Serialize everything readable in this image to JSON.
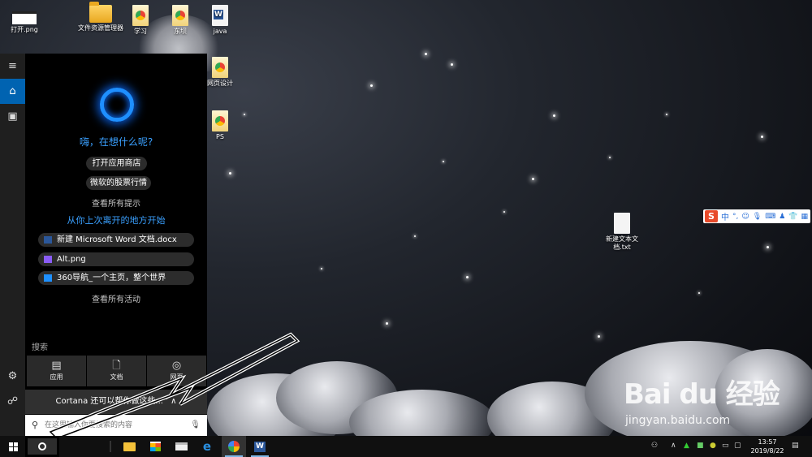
{
  "desktop_icons": [
    {
      "label": "打开.png",
      "icon": "image-file-icon"
    },
    {
      "label": "文件资源管理器",
      "icon": "file-explorer-icon"
    },
    {
      "label": "学习",
      "icon": "shortcut-icon"
    },
    {
      "label": "东坝",
      "icon": "shortcut-icon"
    },
    {
      "label": "java",
      "icon": "word-doc-icon"
    },
    {
      "label": "网页设计",
      "icon": "folder-icon"
    },
    {
      "label": "PS",
      "icon": "folder-icon"
    },
    {
      "label": "新建文本文档.txt",
      "icon": "text-file-icon"
    }
  ],
  "cortana": {
    "greeting": "嗨，在想什么呢?",
    "suggestions": [
      "打开应用商店",
      "微软的股票行情"
    ],
    "see_all_tips": "查看所有提示",
    "resume_heading": "从你上次离开的地方开始",
    "recent_items": [
      {
        "label": "新建 Microsoft Word 文档.docx",
        "icon": "word-doc-icon",
        "color": "#2b579a"
      },
      {
        "label": "Alt.png",
        "icon": "image-file-icon",
        "color": "#8a5cf6"
      },
      {
        "label": "360导航_一个主页，整个世界",
        "icon": "browser-page-icon",
        "color": "#1e90ff"
      }
    ],
    "see_all_activity": "查看所有活动",
    "search_label": "搜索",
    "categories": [
      {
        "label": "应用",
        "icon": "apps-icon"
      },
      {
        "label": "文档",
        "icon": "document-icon"
      },
      {
        "label": "网页",
        "icon": "globe-icon"
      }
    ],
    "help_bar": "Cortana 还可以帮你做这些...",
    "search_placeholder": "在这里输入你要搜索的内容"
  },
  "ime": {
    "mode": "中"
  },
  "taskbar": {
    "time": "13:57",
    "date": "2019/8/22"
  },
  "watermark": {
    "brand": "Bai du 经验",
    "url": "jingyan.baidu.com"
  },
  "colors": {
    "accent": "#0063b1",
    "cortana_blue": "#3aa0ff"
  }
}
